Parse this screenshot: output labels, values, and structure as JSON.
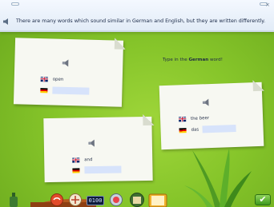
{
  "banner": {
    "text": "There are many words which sound similar in German and English, but they are written differently.",
    "close_icon": "×"
  },
  "instruction": {
    "prefix": "Type in the ",
    "emphasis": "German",
    "suffix": " word!"
  },
  "cards": [
    {
      "english": "open",
      "german_article": "",
      "german_value": ""
    },
    {
      "english": "and",
      "german_article": "",
      "german_value": ""
    },
    {
      "english": "the beer",
      "german_article": "das",
      "german_value": ""
    }
  ],
  "toolbar": {
    "timer": "0100",
    "check_symbol": "✔"
  },
  "colors": {
    "background": "#86c52a",
    "banner": "#eef4fb",
    "input": "#d7e3fb",
    "card": "#f7f8f2"
  },
  "icons": [
    "speaker-icon",
    "uk-flag-icon",
    "german-flag-icon",
    "checkmark-icon",
    "close-icon"
  ]
}
